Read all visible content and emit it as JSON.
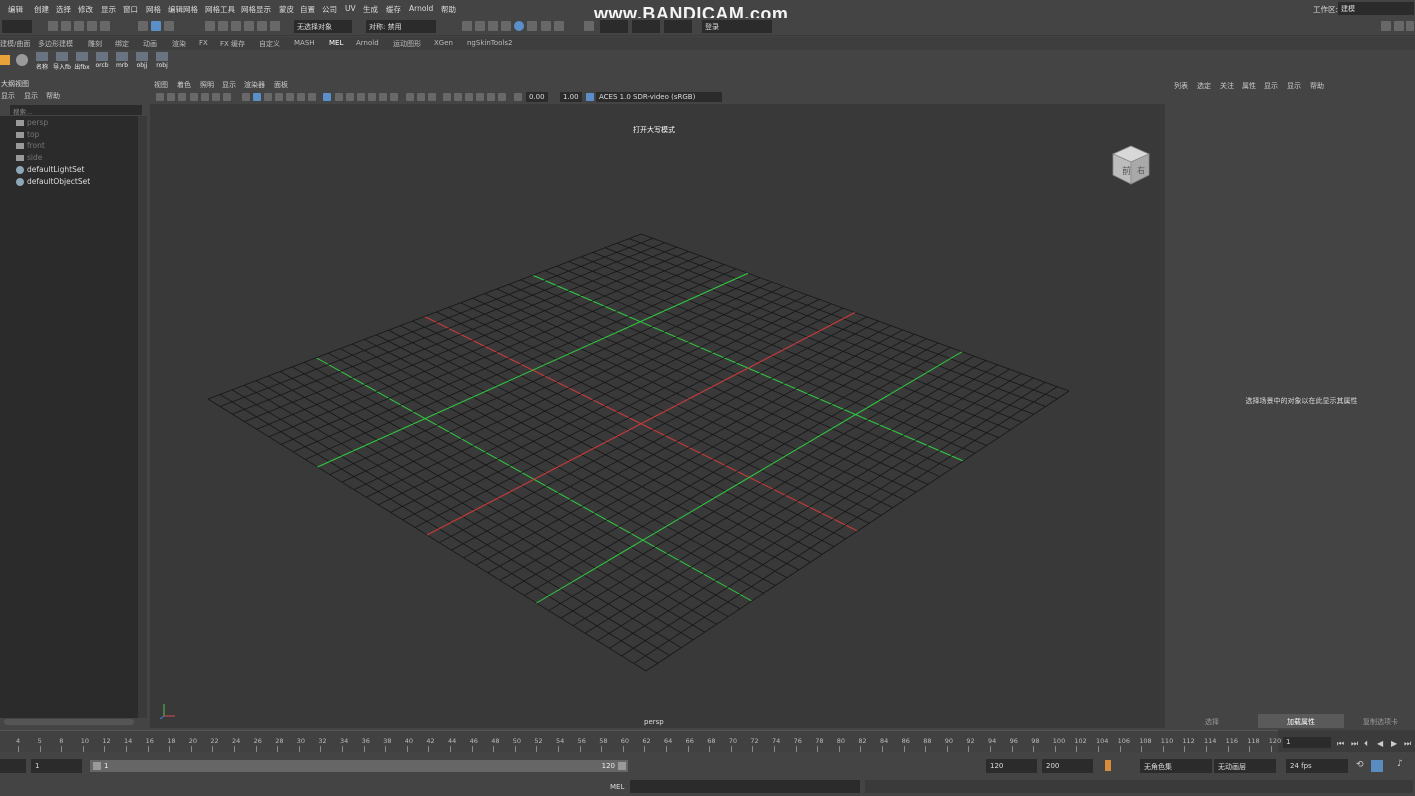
{
  "menubar": {
    "items": [
      "编辑",
      "创建",
      "选择",
      "修改",
      "显示",
      "窗口",
      "网格",
      "编辑网格",
      "网格工具",
      "网格显示",
      "蒙皮",
      "自置",
      "公司",
      "UV",
      "生成",
      "缓存",
      "Arnold",
      "帮助"
    ],
    "workspace_label": "工作区:",
    "workspace_value": "建模"
  },
  "watermark": "www.BANDICAM.com",
  "toolbar": {
    "object_mode": "无选择对象",
    "symmetry": "对称: 禁用",
    "login": "登录"
  },
  "shelf_tabs": [
    "建模/曲面",
    "多边形建模",
    "雕刻",
    "绑定",
    "动画",
    "渲染",
    "FX",
    "FX 缓存",
    "自定义",
    "MASH",
    "MEL",
    "Arnold",
    "运动图形",
    "XGen",
    "ngSkinTools2"
  ],
  "shelf_active_tab": "MEL",
  "shelf_icons": [
    "名称",
    "导入fbx",
    "出fbx",
    "orcb",
    "mrb",
    "objj",
    "robj"
  ],
  "outliner": {
    "title": "大纲视图",
    "menu": [
      "显示",
      "显示",
      "帮助"
    ],
    "search_placeholder": "搜索...",
    "items": [
      {
        "label": "persp",
        "type": "camera",
        "dim": true
      },
      {
        "label": "top",
        "type": "camera",
        "dim": true
      },
      {
        "label": "front",
        "type": "camera",
        "dim": true
      },
      {
        "label": "side",
        "type": "camera",
        "dim": true
      },
      {
        "label": "defaultLightSet",
        "type": "set",
        "dim": false
      },
      {
        "label": "defaultObjectSet",
        "type": "set",
        "dim": false
      }
    ]
  },
  "viewport": {
    "menu": [
      "视图",
      "着色",
      "照明",
      "显示",
      "渲染器",
      "面板"
    ],
    "exposure": "0.00",
    "gamma": "1.00",
    "color_space": "ACES 1.0 SDR-video (sRGB)",
    "hud_title": "打开大写模式",
    "camera_name": "persp",
    "viewcube_labels": [
      "前",
      "右"
    ]
  },
  "attribute_editor": {
    "menu": [
      "列表",
      "选定",
      "关注",
      "属性",
      "显示",
      "显示",
      "帮助"
    ],
    "message": "选择场景中的对象以在此显示其属性",
    "bottom_tabs": [
      "选择",
      "加载属性",
      "复制选项卡"
    ],
    "active_tab": "加载属性"
  },
  "timeline": {
    "ticks": [
      "4",
      "5",
      "8",
      "10",
      "12",
      "14",
      "16",
      "18",
      "20",
      "22",
      "24",
      "26",
      "28",
      "30",
      "32",
      "34",
      "36",
      "38",
      "40",
      "42",
      "44",
      "46",
      "48",
      "50",
      "52",
      "54",
      "56",
      "58",
      "60",
      "62",
      "64",
      "66",
      "68",
      "70",
      "72",
      "74",
      "76",
      "78",
      "80",
      "82",
      "84",
      "86",
      "88",
      "90",
      "92",
      "94",
      "96",
      "98",
      "100",
      "102",
      "104",
      "106",
      "108",
      "110",
      "112",
      "114",
      "116",
      "118",
      "120"
    ],
    "current_frame": "1"
  },
  "range": {
    "start": "1",
    "slider_start": "1",
    "slider_end": "120",
    "end": "120",
    "max_end": "200",
    "character_set": "无角色集",
    "anim_layer": "无动画层",
    "fps": "24 fps"
  },
  "cmdline": {
    "label": "MEL"
  },
  "colors": {
    "grid_line": "#161616",
    "grid_green": "#2ecc40",
    "grid_red": "#c83a3a",
    "viewport_bg": "#393939",
    "panel_bg": "#444444"
  }
}
